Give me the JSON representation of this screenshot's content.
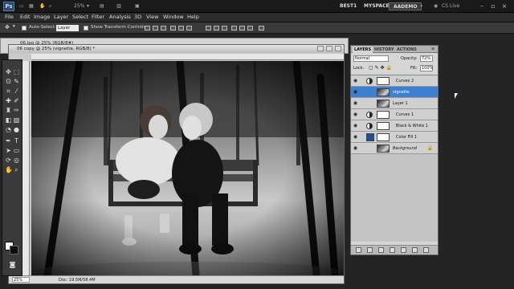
{
  "app": {
    "logo": "Ps",
    "zoom": "25%",
    "workspaces": [
      "BEST1",
      "MYSPACE",
      "AADEMO"
    ],
    "active_workspace": "AADEMO",
    "cs_live": "CS Live"
  },
  "menu": [
    "File",
    "Edit",
    "Image",
    "Layer",
    "Select",
    "Filter",
    "Analysis",
    "3D",
    "View",
    "Window",
    "Help"
  ],
  "options": {
    "auto_select_label": "Auto-Select:",
    "auto_select_value": "Layer",
    "show_transform_label": "Show Transform Controls"
  },
  "doc_back": {
    "title": "06.jpg @ 25% (RGB/8#)"
  },
  "doc": {
    "title": "06 copy @ 25% (vignette, RGB/8) *",
    "zoom": "25%",
    "doc_info": "Doc: 19.5M/58.4M"
  },
  "layers_panel": {
    "tabs": [
      "LAYERS",
      "HISTORY",
      "ACTIONS"
    ],
    "blend_mode": "Normal",
    "opacity_label": "Opacity:",
    "opacity": "72%",
    "lock_label": "Lock:",
    "fill_label": "Fill:",
    "fill": "100%",
    "layers": [
      {
        "name": "Curves 2",
        "kind": "adjustment",
        "selected": false
      },
      {
        "name": "vignette",
        "kind": "image",
        "selected": true
      },
      {
        "name": "Layer 1",
        "kind": "image",
        "selected": false
      },
      {
        "name": "Curves 1",
        "kind": "adjustment",
        "selected": false
      },
      {
        "name": "Black & White 1",
        "kind": "adjustment",
        "selected": false
      },
      {
        "name": "Color Fill 1",
        "kind": "fill",
        "selected": false
      },
      {
        "name": "Background",
        "kind": "background",
        "selected": false
      }
    ]
  },
  "colors": {
    "selected_layer": "#3d7fd0",
    "workspace_bar": "#1a1a1a"
  }
}
